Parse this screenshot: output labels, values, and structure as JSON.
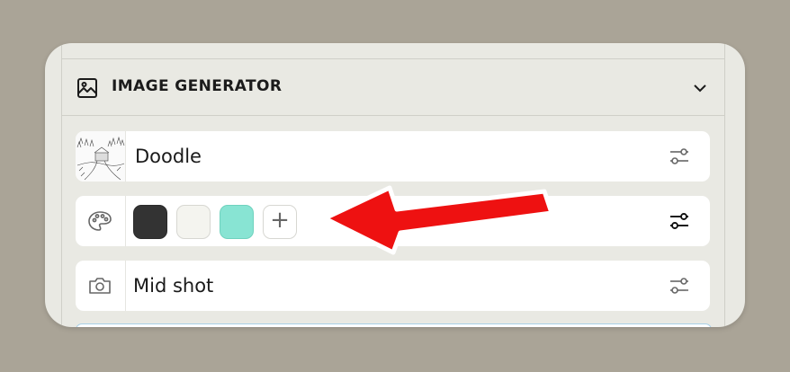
{
  "panel": {
    "title": "IMAGE GENERATOR",
    "header_icon": "image-icon",
    "collapse_icon": "chevron-down-icon"
  },
  "rows": {
    "style": {
      "label": "Doodle",
      "thumbnail": "doodle-cabin-thumbnail",
      "action_icon": "sliders-icon"
    },
    "palette": {
      "lead_icon": "palette-icon",
      "swatches": [
        "#333333",
        "#f4f4ef",
        "#88e4d3"
      ],
      "add_label": "+",
      "action_icon": "sliders-icon"
    },
    "shot": {
      "label": "Mid shot",
      "lead_icon": "camera-icon",
      "action_icon": "sliders-icon"
    }
  },
  "annotation": {
    "arrow_color": "#ee1111",
    "arrow_icon": "red-arrow-pointer"
  }
}
